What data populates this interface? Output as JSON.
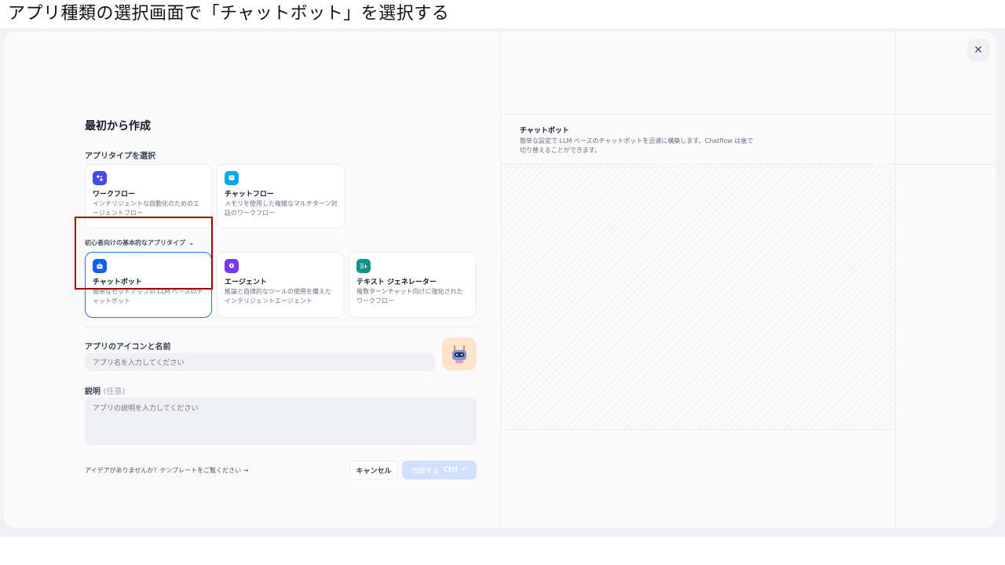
{
  "caption": "アプリ種類の選択画面で「チャットボット」を選択する",
  "modal": {
    "title": "最初から作成",
    "app_type_label": "アプリタイプを選択",
    "types": [
      {
        "title": "ワークフロー",
        "desc": "インテリジェントな自動化のためのエージェントフロー",
        "color": "#444ce7"
      },
      {
        "title": "チャットフロー",
        "desc": "メモリを使用した複雑なマルチターン対話のワークフロー",
        "color": "#0ba5ec"
      }
    ],
    "basic_toggle": "初心者向けの基本的なアプリタイプ",
    "basic_types": [
      {
        "title": "チャットボット",
        "desc": "簡単なセットアップの LLM ベースのチャットボット",
        "color": "#155eef"
      },
      {
        "title": "エージェント",
        "desc": "推論と自律的なツールの使用を備えたインテリジェントエージェント",
        "color": "#7839ee"
      },
      {
        "title": "テキスト ジェネレーター",
        "desc": "複数ターンチャット向けに強化されたワークフロー",
        "color": "#0e9384"
      }
    ],
    "name_label": "アプリのアイコンと名前",
    "name_placeholder": "アプリ名を入力してください",
    "desc_label": "説明",
    "desc_optional": "(任意)",
    "desc_placeholder": "アプリの説明を入力してください",
    "template_link": "アイデアがありませんか？テンプレートをご覧ください",
    "cancel": "キャンセル",
    "create": "作成する",
    "create_shortcut": "Ctrl"
  },
  "preview": {
    "title": "チャットボット",
    "desc": "簡単な設定で LLM ベースのチャットボットを迅速に構築します。Chatflow は後で切り替えることができます。"
  }
}
